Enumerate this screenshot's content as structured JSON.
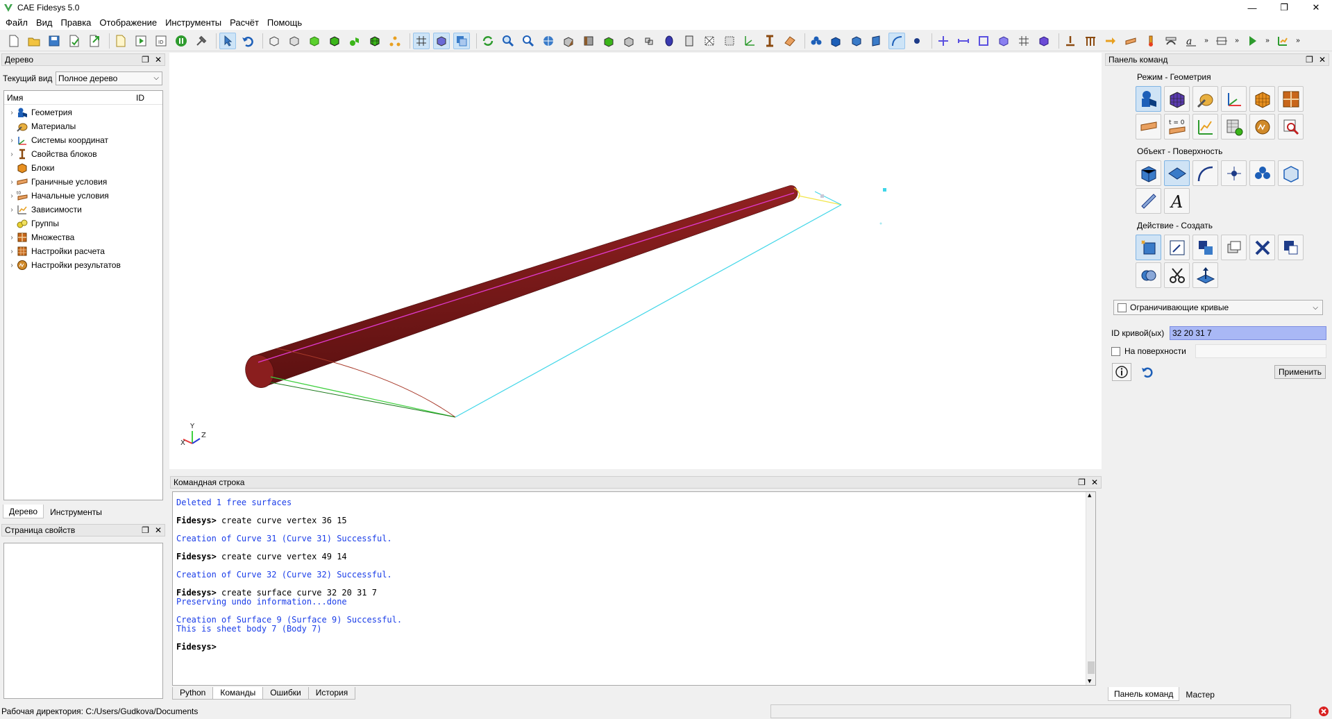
{
  "window": {
    "title": "CAE Fidesys 5.0",
    "minimize": "—",
    "restore": "❐",
    "close": "✕"
  },
  "menu": [
    "Файл",
    "Вид",
    "Правка",
    "Отображение",
    "Инструменты",
    "Расчёт",
    "Помощь"
  ],
  "tree_panel": {
    "title": "Дерево",
    "view_label": "Текущий вид",
    "view_value": "Полное дерево",
    "col_name": "Имя",
    "col_id": "ID",
    "items": [
      {
        "label": "Геометрия",
        "icon": "geometry-icon",
        "expandable": true
      },
      {
        "label": "Материалы",
        "icon": "materials-icon",
        "expandable": false
      },
      {
        "label": "Системы координат",
        "icon": "coordinate-systems-icon",
        "expandable": true
      },
      {
        "label": "Свойства блоков",
        "icon": "block-properties-icon",
        "expandable": true
      },
      {
        "label": "Блоки",
        "icon": "blocks-icon",
        "expandable": false
      },
      {
        "label": "Граничные условия",
        "icon": "boundary-conditions-icon",
        "expandable": true
      },
      {
        "label": "Начальные условия",
        "icon": "initial-conditions-icon",
        "expandable": true
      },
      {
        "label": "Зависимости",
        "icon": "dependencies-icon",
        "expandable": true
      },
      {
        "label": "Группы",
        "icon": "groups-icon",
        "expandable": false
      },
      {
        "label": "Множества",
        "icon": "sets-icon",
        "expandable": true
      },
      {
        "label": "Настройки расчета",
        "icon": "calc-settings-icon",
        "expandable": true
      },
      {
        "label": "Настройки результатов",
        "icon": "results-settings-icon",
        "expandable": true
      }
    ],
    "tabs": [
      "Дерево",
      "Инструменты"
    ]
  },
  "props_panel": {
    "title": "Страница свойств"
  },
  "command_line": {
    "title": "Командная строка",
    "lines": [
      {
        "type": "msg",
        "text": "Deleted 1 free surfaces"
      },
      {
        "type": "cmd",
        "prompt": "Fidesys>",
        "text": " create curve vertex 36 15"
      },
      {
        "type": "msg",
        "text": "Creation of Curve 31 (Curve 31) Successful."
      },
      {
        "type": "cmd",
        "prompt": "Fidesys>",
        "text": " create curve vertex 49 14"
      },
      {
        "type": "msg",
        "text": "Creation of Curve 32 (Curve 32) Successful."
      },
      {
        "type": "cmd",
        "prompt": "Fidesys>",
        "text": " create surface curve 32 20 31 7"
      },
      {
        "type": "msg",
        "text": "Preserving undo information...done"
      },
      {
        "type": "msg",
        "text": "Creation of Surface 9 (Surface 9) Successful."
      },
      {
        "type": "msg",
        "text": "This is sheet body 7 (Body 7)"
      },
      {
        "type": "cmd",
        "prompt": "Fidesys>",
        "text": ""
      }
    ],
    "tabs": [
      "Python",
      "Команды",
      "Ошибки",
      "История"
    ]
  },
  "command_panel": {
    "title": "Панель команд",
    "mode_title": "Режим - Геометрия",
    "object_title": "Объект - Поверхность",
    "action_title": "Действие - Создать",
    "curves_dropdown": "Ограничивающие кривые",
    "curve_id_label": "ID кривой(ых)",
    "curve_id_value": "32 20 31 7",
    "on_surface_label": "На поверхности",
    "apply_label": "Применить",
    "t0_label": "t = 0",
    "tabs": [
      "Панель команд",
      "Мастер"
    ]
  },
  "axes": {
    "x": "X",
    "y": "Y",
    "z": "Z"
  },
  "status": {
    "workdir": "Рабочая директория: C:/Users/Gudkova/Documents"
  },
  "colors": {
    "pipe": "#7a1a1a",
    "accent_blue": "#1a3de8",
    "selection": "#a9b8f5"
  }
}
